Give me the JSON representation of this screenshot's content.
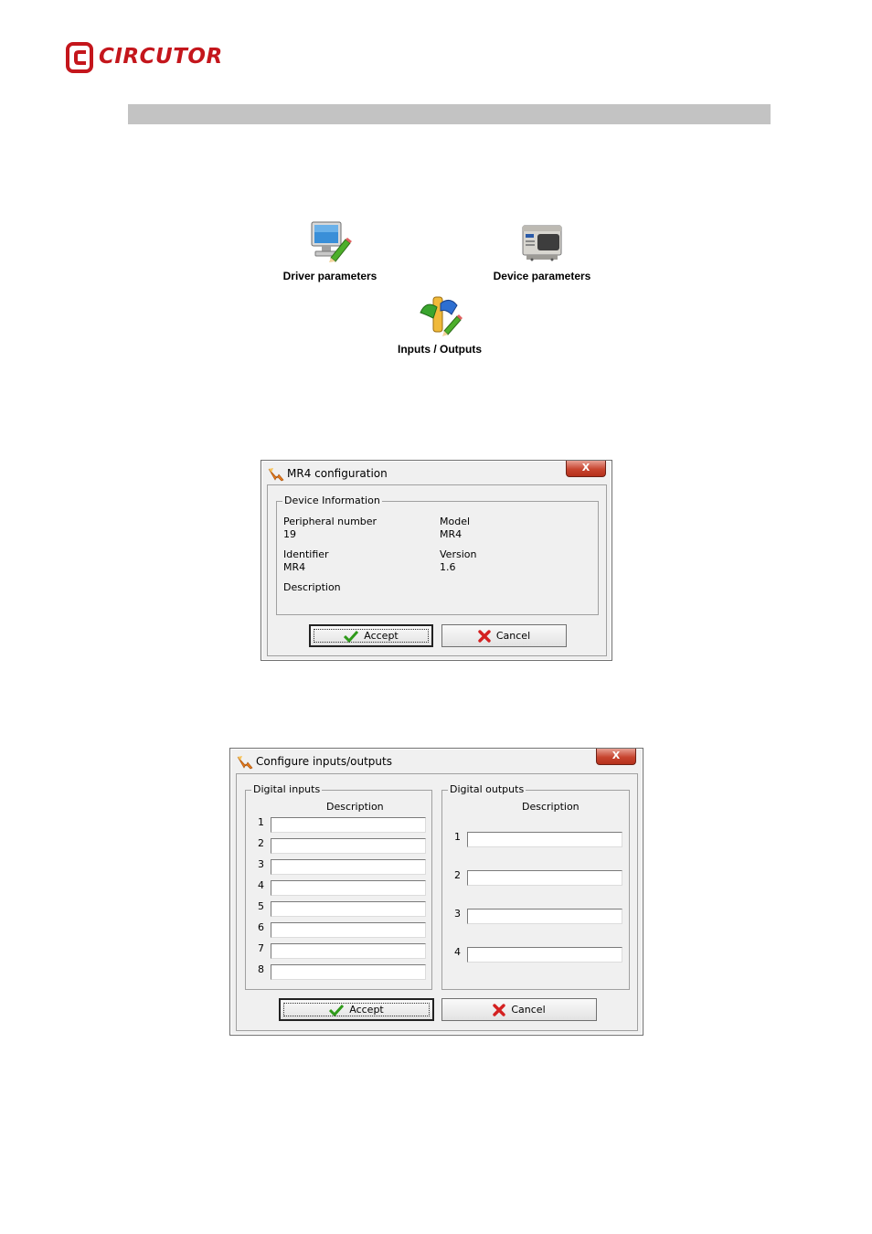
{
  "brand": {
    "name": "CIRCUTOR",
    "color": "#c4161c"
  },
  "icons": {
    "driver": {
      "label": "Driver parameters",
      "icon": "monitor-pencil-icon"
    },
    "device": {
      "label": "Device parameters",
      "icon": "device-module-icon"
    },
    "io": {
      "label": "Inputs / Outputs",
      "icon": "io-plugs-icon"
    }
  },
  "mr4_dialog": {
    "title": "MR4 configuration",
    "close_label": "X",
    "group_title": "Device Information",
    "peripheral_label": "Peripheral number",
    "peripheral_value": "19",
    "model_label": "Model",
    "model_value": "MR4",
    "identifier_label": "Identifier",
    "identifier_value": "MR4",
    "version_label": "Version",
    "version_value": "1.6",
    "description_label": "Description",
    "accept_label": "Accept",
    "cancel_label": "Cancel"
  },
  "io_dialog": {
    "title": "Configure inputs/outputs",
    "close_label": "X",
    "inputs_group": "Digital inputs",
    "inputs_header": "Description",
    "outputs_group": "Digital outputs",
    "outputs_header": "Description",
    "inputs": [
      "1",
      "2",
      "3",
      "4",
      "5",
      "6",
      "7",
      "8"
    ],
    "outputs": [
      "1",
      "2",
      "3",
      "4"
    ],
    "accept_label": "Accept",
    "cancel_label": "Cancel"
  }
}
